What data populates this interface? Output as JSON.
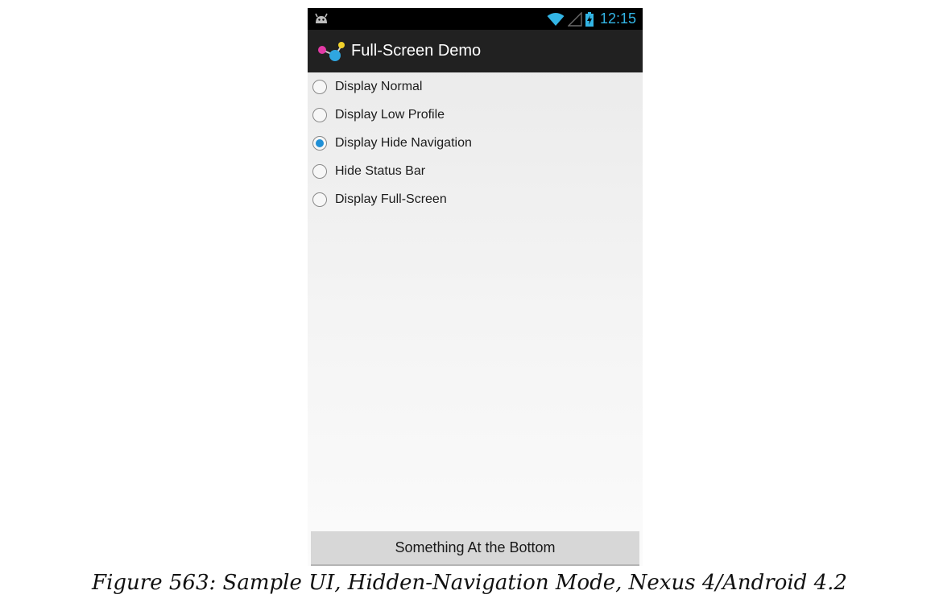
{
  "status_bar": {
    "time": "12:15",
    "icons": [
      "android-notification-icon",
      "wifi-icon",
      "signal-icon",
      "battery-charging-icon"
    ],
    "accent_color": "#33b5e5"
  },
  "action_bar": {
    "title": "Full-Screen Demo",
    "icon": "app-molecule-icon"
  },
  "radio_group": {
    "options": [
      {
        "label": "Display Normal",
        "checked": false
      },
      {
        "label": "Display Low Profile",
        "checked": false
      },
      {
        "label": "Display Hide Navigation",
        "checked": true
      },
      {
        "label": "Hide Status Bar",
        "checked": false
      },
      {
        "label": "Display Full-Screen",
        "checked": false
      }
    ],
    "checked_color": "#1f8fd6"
  },
  "bottom_button": {
    "label": "Something At the Bottom"
  },
  "caption": "Figure 563: Sample UI, Hidden-Navigation Mode, Nexus 4/Android 4.2"
}
